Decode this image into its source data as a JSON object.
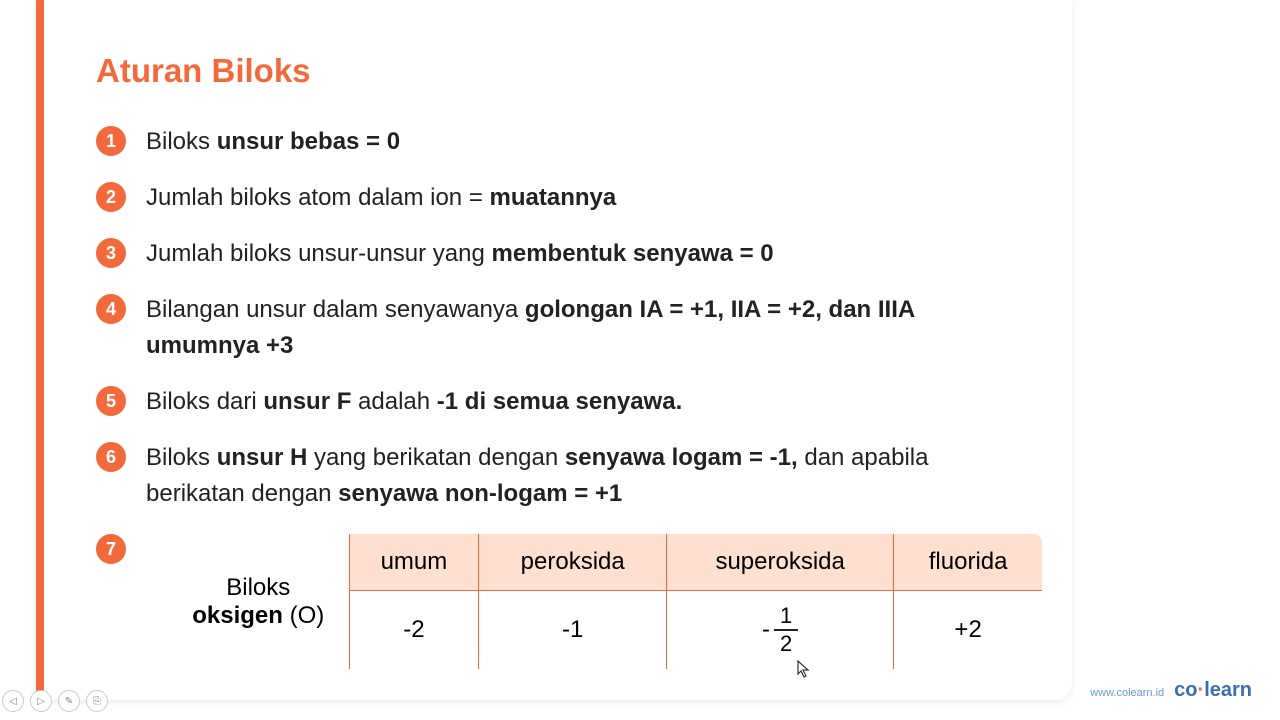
{
  "title": "Aturan Biloks",
  "rules": [
    {
      "num": "1",
      "prefix": "Biloks ",
      "bold1": "unsur bebas = 0",
      "mid": "",
      "bold2": "",
      "tail": ""
    },
    {
      "num": "2",
      "prefix": "Jumlah biloks atom dalam ion = ",
      "bold1": "muatannya",
      "mid": "",
      "bold2": "",
      "tail": ""
    },
    {
      "num": "3",
      "prefix": "Jumlah biloks unsur-unsur yang ",
      "bold1": "membentuk senyawa = 0",
      "mid": "",
      "bold2": "",
      "tail": ""
    },
    {
      "num": "4",
      "prefix": "Bilangan unsur dalam senyawanya ",
      "bold1": "golongan IA = +1, IIA = +2, dan IIIA umumnya +3",
      "mid": "",
      "bold2": "",
      "tail": ""
    },
    {
      "num": "5",
      "prefix": "Biloks dari ",
      "bold1": "unsur F",
      "mid": " adalah ",
      "bold2": "-1 di semua senyawa.",
      "tail": ""
    },
    {
      "num": "6",
      "prefix": "Biloks ",
      "bold1": "unsur H",
      "mid": " yang berikatan dengan ",
      "bold2": "senyawa logam = -1,",
      "tail": " dan apabila berikatan dengan ",
      "bold3": "senyawa non-logam = +1"
    },
    {
      "num": "7",
      "prefix": "",
      "bold1": "",
      "mid": "",
      "bold2": "",
      "tail": ""
    }
  ],
  "table": {
    "rowhead_pre": "Biloks",
    "rowhead_bold": "oksigen",
    "rowhead_post": " (O)",
    "headers": [
      "umum",
      "peroksida",
      "superoksida",
      "fluorida"
    ],
    "values": [
      "-2",
      "-1",
      "-½",
      "+2"
    ],
    "frac_sign": "-",
    "frac_num": "1",
    "frac_den": "2"
  },
  "footer": {
    "url": "www.colearn.id",
    "brand_a": "co",
    "brand_dot": "·",
    "brand_b": "learn"
  },
  "toolbar": [
    "◁",
    "▷",
    "✎",
    "⎘"
  ]
}
